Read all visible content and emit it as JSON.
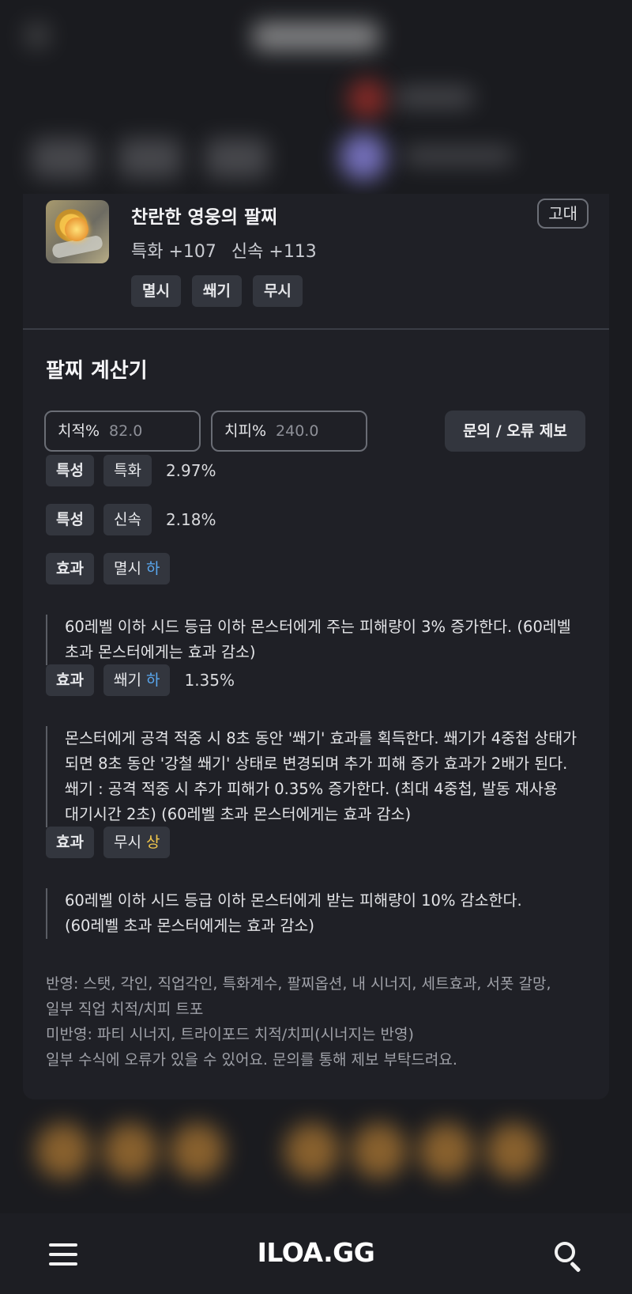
{
  "item": {
    "name": "찬란한 영웅의 팔찌",
    "stats": [
      "특화 +107",
      "신속 +113"
    ],
    "grade": "고대",
    "tags": [
      "멸시",
      "쐐기",
      "무시"
    ]
  },
  "calculator": {
    "title": "팔찌 계산기",
    "crit_rate_label": "치적%",
    "crit_rate_value": "82.0",
    "crit_dmg_label": "치피%",
    "crit_dmg_value": "240.0",
    "report_button": "문의 / 오류 제보",
    "rows": [
      {
        "type": "특성",
        "name": "특화",
        "grade": "",
        "value": "2.97%"
      },
      {
        "type": "특성",
        "name": "신속",
        "grade": "",
        "value": "2.18%"
      },
      {
        "type": "효과",
        "name": "멸시",
        "grade": "하",
        "value": ""
      },
      {
        "type": "효과",
        "name": "쐐기",
        "grade": "하",
        "value": "1.35%"
      },
      {
        "type": "효과",
        "name": "무시",
        "grade": "상",
        "value": ""
      }
    ],
    "descriptions": {
      "myeolsi": [
        "60레벨 이하 시드 등급 이하 몬스터에게 주는 피해량이 3% 증가한다. (60레벨",
        "초과 몬스터에게는 효과 감소)"
      ],
      "sswaegi": [
        "몬스터에게 공격 적중 시 8초 동안 '쐐기' 효과를 획득한다. 쐐기가 4중첩 상태가",
        "되면 8초 동안 '강철 쐐기' 상태로 변경되며 추가 피해 증가 효과가 2배가 된다.",
        "쐐기 : 공격 적중 시 추가 피해가 0.35% 증가한다. (최대 4중첩, 발동 재사용",
        "대기시간 2초) (60레벨 초과 몬스터에게는 효과 감소)"
      ],
      "musi": [
        "60레벨 이하 시드 등급 이하 몬스터에게 받는 피해량이 10% 감소한다.",
        "(60레벨 초과 몬스터에게는 효과 감소)"
      ]
    },
    "footnotes": [
      "반영: 스탯, 각인, 직업각인, 특화계수, 팔찌옵션, 내 시너지, 세트효과, 서폿 갈망,",
      "일부 직업 치적/치피 트포",
      "미반영: 파티 시너지, 트라이포드 치적/치피(시너지는 반영)",
      "일부 수식에 오류가 있을 수 있어요. 문의를 통해 제보 부탁드려요."
    ]
  },
  "nav": {
    "logo": "ILOA.GG",
    "menu_icon": "hamburger-icon",
    "search_icon": "search-icon"
  },
  "colors": {
    "grade_low": "#5aa8f0",
    "grade_high": "#f3c84c",
    "background": "#1a1b1f",
    "card": "#1f2026"
  }
}
